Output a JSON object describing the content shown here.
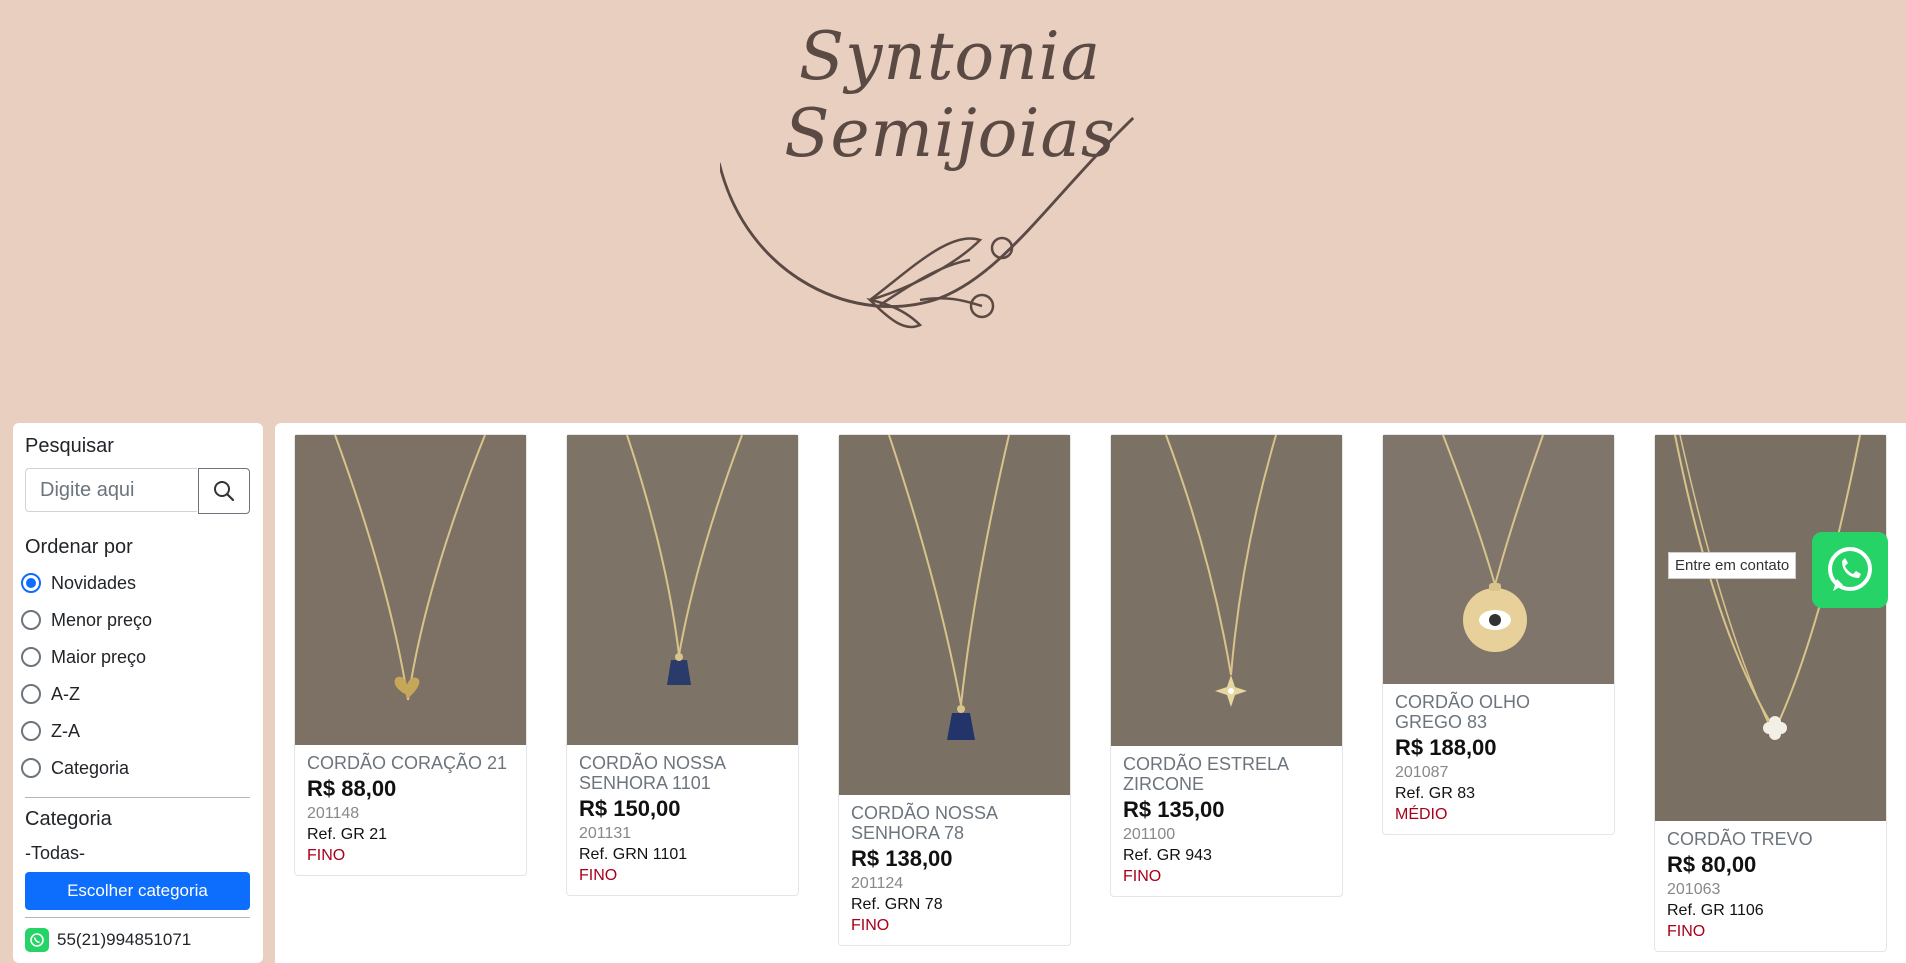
{
  "brand": {
    "name": "Syntonia Semijoias"
  },
  "sidebar": {
    "search_label": "Pesquisar",
    "search_placeholder": "Digite aqui",
    "sort_label": "Ordenar por",
    "sort_options": [
      {
        "label": "Novidades",
        "selected": true
      },
      {
        "label": "Menor preço",
        "selected": false
      },
      {
        "label": "Maior preço",
        "selected": false
      },
      {
        "label": "A-Z",
        "selected": false
      },
      {
        "label": "Z-A",
        "selected": false
      },
      {
        "label": "Categoria",
        "selected": false
      }
    ],
    "category_label": "Categoria",
    "category_value": "-Todas-",
    "choose_category_button": "Escolher categoria",
    "phone": "55(21)994851071"
  },
  "products": [
    {
      "name": "CORDÃO CORAÇÃO 21",
      "price": "R$ 88,00",
      "code": "201148",
      "ref": "Ref. GR 21",
      "tag": "FINO",
      "pendant": "heart"
    },
    {
      "name": "CORDÃO NOSSA SENHORA 1101",
      "price": "R$ 150,00",
      "code": "201131",
      "ref": "Ref. GRN 1101",
      "tag": "FINO",
      "pendant": "mary"
    },
    {
      "name": "CORDÃO NOSSA SENHORA 78",
      "price": "R$ 138,00",
      "code": "201124",
      "ref": "Ref. GRN 78",
      "tag": "FINO",
      "pendant": "mary"
    },
    {
      "name": "CORDÃO ESTRELA ZIRCONE",
      "price": "R$ 135,00",
      "code": "201100",
      "ref": "Ref. GR 943",
      "tag": "FINO",
      "pendant": "star"
    },
    {
      "name": "CORDÃO OLHO GREGO 83",
      "price": "R$ 188,00",
      "code": "201087",
      "ref": "Ref. GR 83",
      "tag": "MÉDIO",
      "pendant": "eye"
    },
    {
      "name": "CORDÃO TREVO",
      "price": "R$ 80,00",
      "code": "201063",
      "ref": "Ref. GR 1106",
      "tag": "FINO",
      "pendant": "clover"
    }
  ],
  "contact": {
    "label": "Entre em contato"
  },
  "colors": {
    "banner": "#e9cfc0",
    "accent": "#0d6efd",
    "whatsapp": "#25d366",
    "tag": "#a8001a"
  }
}
